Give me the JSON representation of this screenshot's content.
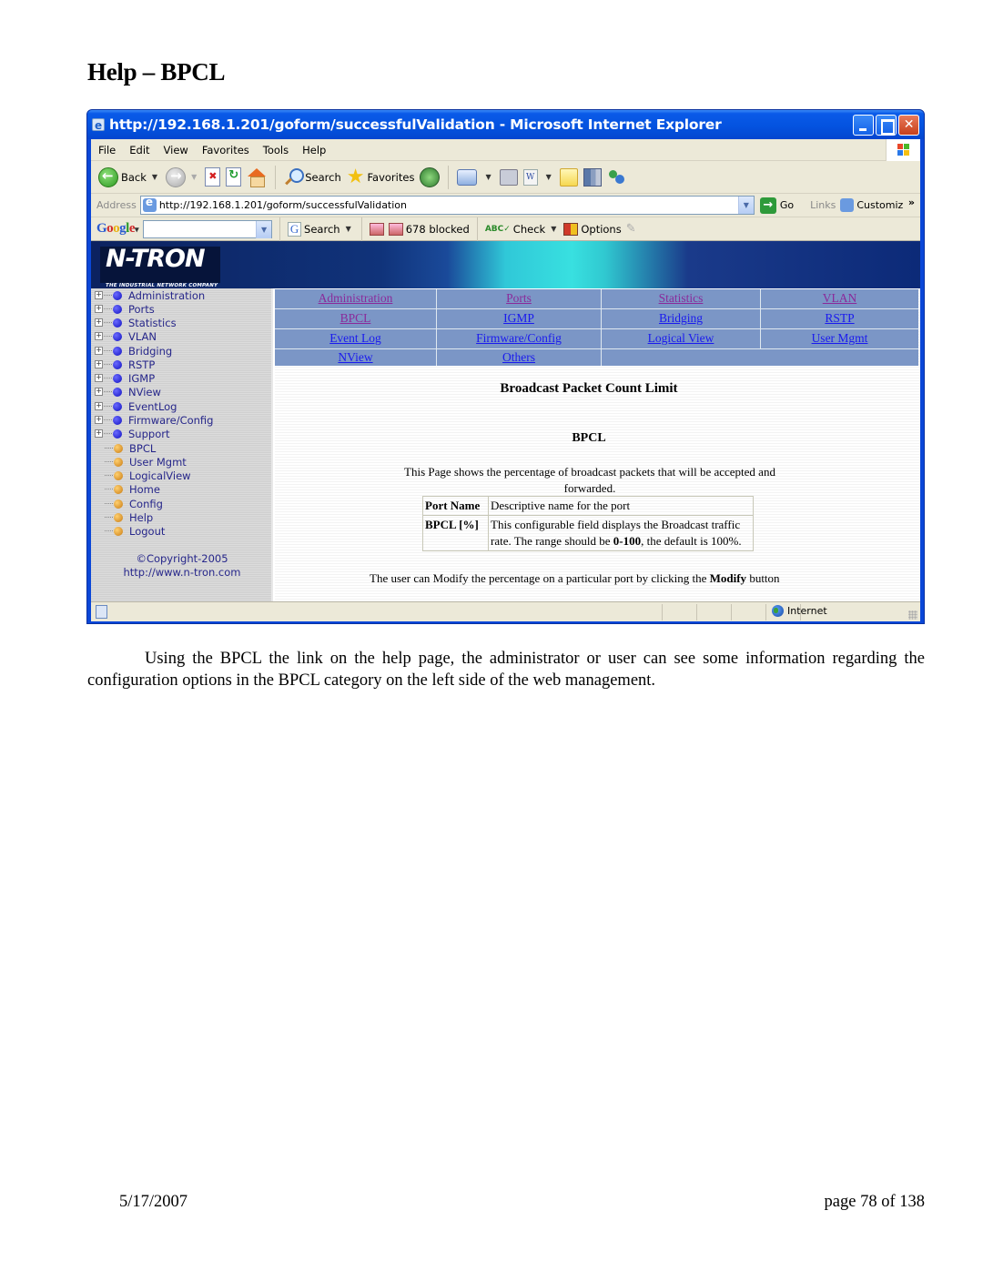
{
  "document": {
    "heading": "Help – BPCL",
    "body": "Using the BPCL the link on the help page, the administrator or user can see some information regarding the configuration options in the BPCL category on the left side of the web management.",
    "footer_date": "5/17/2007",
    "footer_page": "page 78 of 138"
  },
  "browser": {
    "title": "http://192.168.1.201/goform/successfulValidation - Microsoft Internet Explorer",
    "menu": [
      "File",
      "Edit",
      "View",
      "Favorites",
      "Tools",
      "Help"
    ],
    "toolbar": {
      "back": "Back",
      "search": "Search",
      "favorites": "Favorites"
    },
    "address": {
      "label": "Address",
      "value": "http://192.168.1.201/goform/successfulValidation",
      "go": "Go",
      "links": "Links",
      "customize": "Customiz"
    },
    "google_bar": {
      "logo": "Google",
      "search": "Search",
      "blocked": "678 blocked",
      "check": "Check",
      "options": "Options"
    },
    "status": {
      "zone": "Internet"
    }
  },
  "webpage": {
    "logo": "N-TRON",
    "logo_tagline": "THE INDUSTRIAL NETWORK COMPANY",
    "tree": {
      "folders": [
        "Administration",
        "Ports",
        "Statistics",
        "VLAN",
        "Bridging",
        "RSTP",
        "IGMP",
        "NView",
        "EventLog",
        "Firmware/Config",
        "Support"
      ],
      "leaves": [
        "BPCL",
        "User Mgmt",
        "LogicalView",
        "Home",
        "Config",
        "Help",
        "Logout"
      ],
      "copyright": "©Copyright-2005",
      "site": "http://www.n-tron.com"
    },
    "nav_links": [
      [
        "Administration",
        "Ports",
        "Statistics",
        "VLAN"
      ],
      [
        "BPCL",
        "IGMP",
        "Bridging",
        "RSTP"
      ],
      [
        "Event Log",
        "Firmware/Config",
        "Logical View",
        "User Mgmt"
      ],
      [
        "NView",
        "Others",
        "",
        ""
      ]
    ],
    "page_title": "Broadcast Packet Count Limit",
    "section_title": "BPCL",
    "description": "This Page shows the percentage of broadcast packets that will be accepted and forwarded.",
    "help_table": [
      {
        "term": "Port Name",
        "definition_pre": "Descriptive name for the port",
        "definition_bold": "",
        "definition_post": ""
      },
      {
        "term": "BPCL [%]",
        "definition_pre": "This configurable field displays the Broadcast traffic rate. The range should be ",
        "definition_bold": "0-100",
        "definition_post": ", the default is 100%."
      }
    ],
    "footer_pre": "The user can Modify the percentage on a particular port by clicking the ",
    "footer_bold": "Modify",
    "footer_post": " button"
  }
}
